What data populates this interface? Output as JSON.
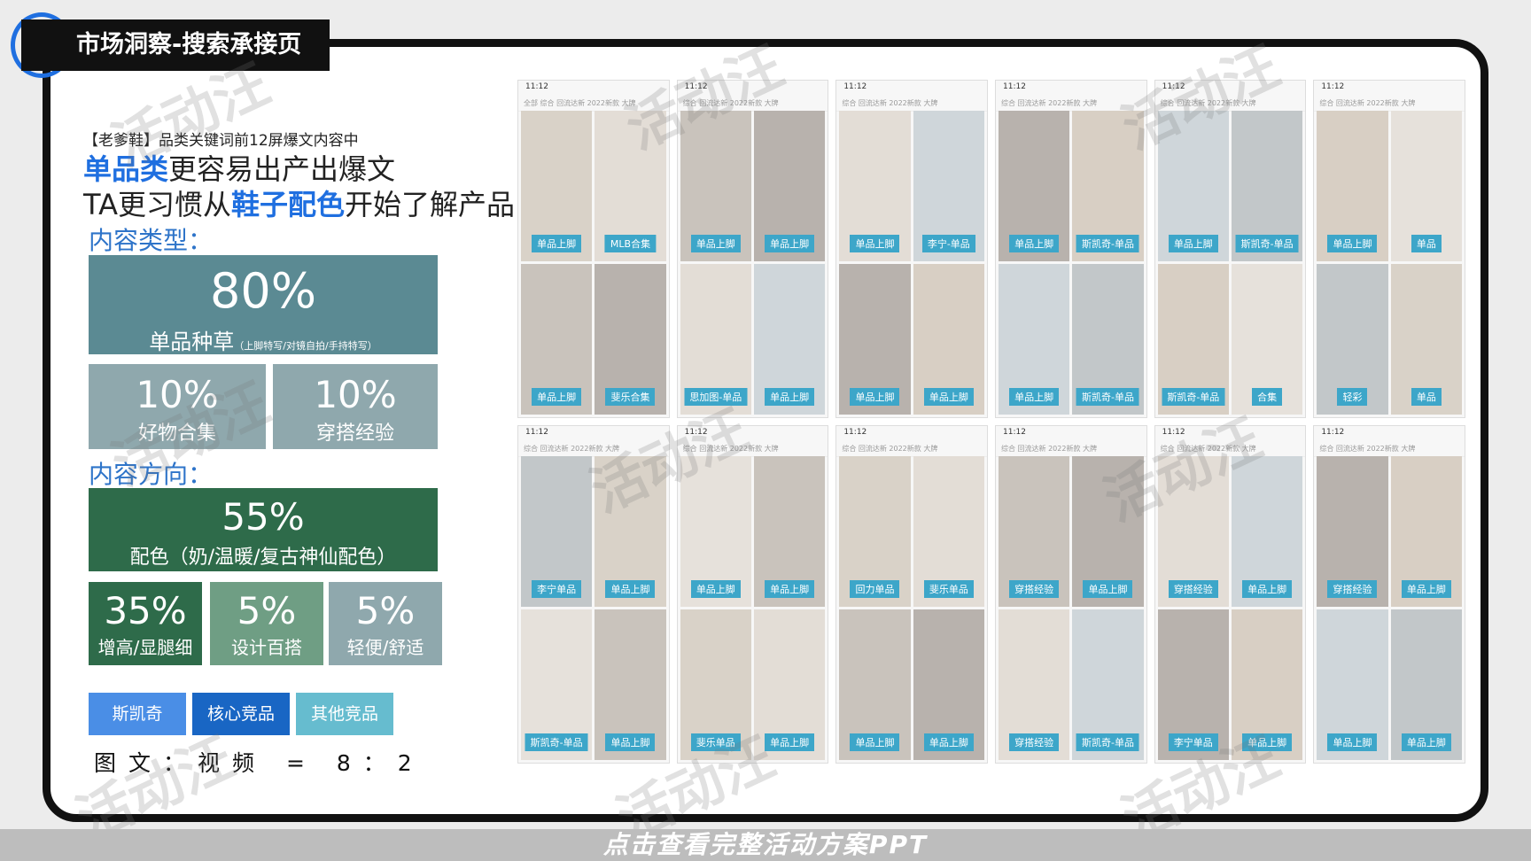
{
  "title": "市场洞察-搜索承接页",
  "subtitle": "【老爹鞋】品类关键词前12屏爆文内容中",
  "headline1": {
    "strong": "单品类",
    "rest": "更容易出产出爆文"
  },
  "headline2": {
    "pre": "TA更习惯从",
    "strong": "鞋子配色",
    "post": "开始了解产品"
  },
  "content_type": {
    "heading": "内容类型：",
    "main": {
      "pct": "80%",
      "label": "单品种草",
      "note": "（上脚特写/对镜自拍/手持特写）"
    },
    "items": [
      {
        "pct": "10%",
        "label": "好物合集"
      },
      {
        "pct": "10%",
        "label": "穿搭经验"
      }
    ]
  },
  "content_direction": {
    "heading": "内容方向：",
    "main": {
      "pct": "55%",
      "label": "配色（奶/温暖/复古神仙配色）"
    },
    "items": [
      {
        "pct": "35%",
        "label": "增高/显腿细"
      },
      {
        "pct": "5%",
        "label": "设计百搭"
      },
      {
        "pct": "5%",
        "label": "轻便/舒适"
      }
    ]
  },
  "tags": [
    "斯凯奇",
    "核心竞品",
    "其他竞品"
  ],
  "ratio": "图文：视频 = 8：2",
  "phones": [
    {
      "time": "11:12",
      "tabs": "全部  综合  回流达新  2022新款  大牌",
      "caps": [
        "单品上脚",
        "单品上脚",
        "MLB合集",
        "斐乐合集"
      ]
    },
    {
      "time": "11:12",
      "tabs": "综合  回流达新  2022新款  大牌",
      "caps": [
        "单品上脚",
        "思加图-单品",
        "单品上脚",
        "单品上脚"
      ]
    },
    {
      "time": "11:12",
      "tabs": "综合  回流达新  2022新款  大牌",
      "caps": [
        "单品上脚",
        "单品上脚",
        "李宁-单品",
        "单品上脚"
      ]
    },
    {
      "time": "11:12",
      "tabs": "综合  回流达新  2022新款  大牌",
      "caps": [
        "单品上脚",
        "单品上脚",
        "斯凯奇-单品",
        "斯凯奇-单品"
      ]
    },
    {
      "time": "11:12",
      "tabs": "综合  回流达新  2022新款  大牌",
      "caps": [
        "单品上脚",
        "斯凯奇-单品",
        "斯凯奇-单品",
        "合集"
      ]
    },
    {
      "time": "11:12",
      "tabs": "综合  回流达新  2022新款  大牌",
      "caps": [
        "单品上脚",
        "轻彩",
        "单品",
        "单品"
      ]
    },
    {
      "time": "11:12",
      "tabs": "综合  回流达新  2022新款  大牌",
      "caps": [
        "李宁单品",
        "斯凯奇-单品",
        "单品上脚",
        "单品上脚"
      ]
    },
    {
      "time": "11:12",
      "tabs": "综合  回流达新  2022新款  大牌",
      "caps": [
        "单品上脚",
        "斐乐单品",
        "单品上脚",
        "单品上脚"
      ]
    },
    {
      "time": "11:12",
      "tabs": "综合  回流达新  2022新款  大牌",
      "caps": [
        "回力单品",
        "单品上脚",
        "斐乐单品",
        "单品上脚"
      ]
    },
    {
      "time": "11:12",
      "tabs": "综合  回流达新  2022新款  大牌",
      "caps": [
        "穿搭经验",
        "穿搭经验",
        "单品上脚",
        "斯凯奇-单品"
      ]
    },
    {
      "time": "11:12",
      "tabs": "综合  回流达新  2022新款  大牌",
      "caps": [
        "穿搭经验",
        "李宁单品",
        "单品上脚",
        "单品上脚"
      ]
    },
    {
      "time": "11:12",
      "tabs": "综合  回流达新  2022新款  大牌",
      "caps": [
        "穿搭经验",
        "单品上脚",
        "单品上脚",
        "单品上脚"
      ]
    }
  ],
  "watermark": "活动汪",
  "banner": "点击查看完整活动方案PPT",
  "colors": {
    "accent": "#1f6fe0",
    "teal_dark": "#5b8a93",
    "teal_light": "#8fa8ad",
    "green_dark": "#2e6b4a",
    "green_mid": "#6f9e84",
    "tag1": "#4a8ee6",
    "tag2": "#1966c4",
    "tag3": "#66bccf"
  }
}
